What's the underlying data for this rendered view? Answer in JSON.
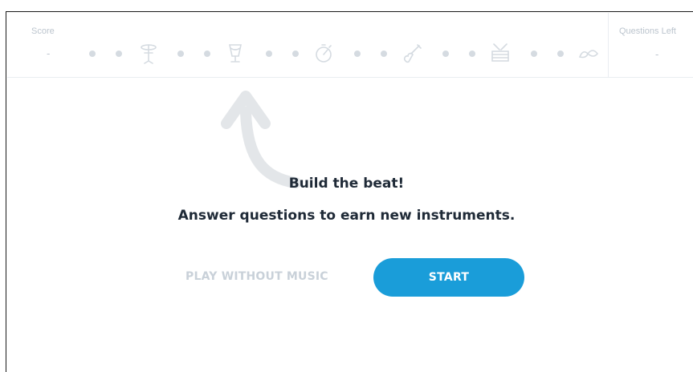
{
  "header": {
    "score_label": "Score",
    "score_value": "-",
    "questions_left_label": "Questions Left",
    "questions_left_value": "-"
  },
  "track": {
    "icons": [
      "cymbal-icon",
      "tambourine-icon",
      "stopwatch-icon",
      "guitar-icon",
      "snare-drum-icon",
      "cowbell-icon"
    ],
    "color": "#d5dbe1"
  },
  "main": {
    "title": "Build the beat!",
    "subtitle": "Answer questions to earn new instruments.",
    "play_without_music_label": "PLAY WITHOUT MUSIC",
    "start_label": "START",
    "accent_color": "#1a9dd9"
  }
}
